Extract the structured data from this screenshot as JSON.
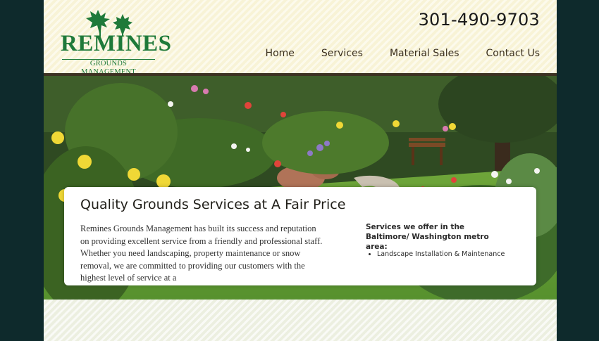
{
  "brand": {
    "name": "REMINES",
    "tagline": "GROUNDS MANAGEMENT"
  },
  "header": {
    "phone": "301-490-9703"
  },
  "nav": {
    "home": "Home",
    "services": "Services",
    "material_sales": "Material Sales",
    "contact_us": "Contact Us"
  },
  "hero": {
    "image": "garden-photo"
  },
  "content": {
    "heading": "Quality Grounds Services at A Fair Price",
    "intro": "Remines Grounds Management has built its success and reputation on providing excellent service from a friendly and professional staff. Whether you need landscaping, property maintenance or snow removal, we are committed to providing our customers with the highest level of service at a",
    "services_heading": "Services we offer in the Baltimore/ Washington metro area:",
    "services": [
      "Landscape Installation & Maintenance"
    ]
  },
  "colors": {
    "brand_green": "#1f7a3a",
    "page_background": "#0e2a2c",
    "header_background": "#f8f3d6",
    "header_rule": "#3c3222"
  }
}
